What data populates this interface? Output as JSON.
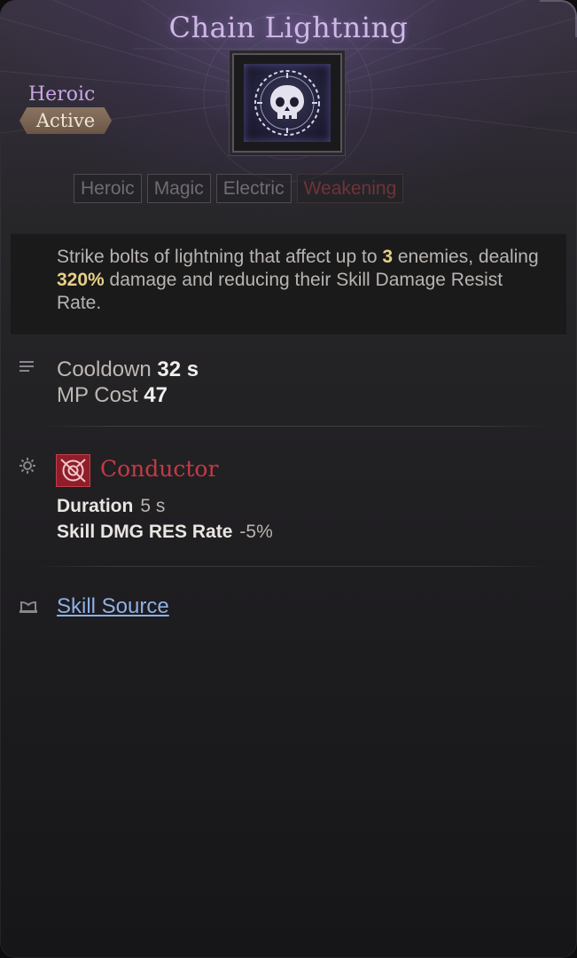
{
  "skill": {
    "name": "Chain Lightning",
    "grade": "Heroic",
    "type": "Active",
    "tags": [
      "Heroic",
      "Magic",
      "Electric",
      "Weakening"
    ],
    "description": {
      "part1": "Strike bolts of lightning that affect up to ",
      "targets": "3",
      "part2": " enemies, dealing ",
      "damage": "320%",
      "part3": " damage and reducing their Skill Damage Resist Rate."
    }
  },
  "stats": {
    "cooldown_label": "Cooldown",
    "cooldown_value": "32 s",
    "mp_label": "MP Cost",
    "mp_value": "47"
  },
  "effect": {
    "name": "Conductor",
    "duration_label": "Duration",
    "duration_value": "5 s",
    "res_label": "Skill DMG RES Rate",
    "res_value": "-5%"
  },
  "source": {
    "link_label": "Skill Source"
  },
  "icons": {
    "stats": "list-icon",
    "effect": "gear-icon",
    "effect_badge": "conductor-icon",
    "source": "book-icon",
    "skill": "skull-emblem-icon"
  },
  "colors": {
    "title": "#cfb8e6",
    "grade": "#c9a6e8",
    "highlight": "#e6cf86",
    "effect_name": "#c33a45",
    "link": "#8db1e4"
  }
}
